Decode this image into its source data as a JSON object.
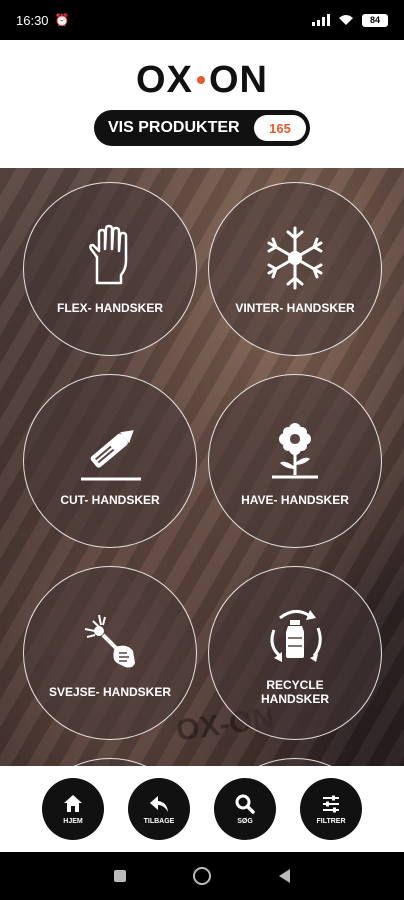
{
  "status_bar": {
    "time": "16:30",
    "battery": "84"
  },
  "header": {
    "logo_left": "OX",
    "logo_right": "ON",
    "vis_label": "VIS PRODUKTER",
    "vis_count": "165"
  },
  "watermark": "OX-ON",
  "categories": [
    {
      "label": "FLEX- HANDSKER",
      "icon": "glove-icon"
    },
    {
      "label": "VINTER- HANDSKER",
      "icon": "snowflake-icon"
    },
    {
      "label": "CUT-  HANDSKER",
      "icon": "cutter-knife-icon"
    },
    {
      "label": "HAVE- HANDSKER",
      "icon": "flower-icon"
    },
    {
      "label": "SVEJSE- HANDSKER",
      "icon": "welding-icon"
    },
    {
      "label": "RECYCLE\nHANDSKER",
      "icon": "recycle-icon"
    }
  ],
  "bottom_nav": [
    {
      "label": "HJEM",
      "icon": "home-icon"
    },
    {
      "label": "TILBAGE",
      "icon": "back-arrow-icon"
    },
    {
      "label": "SØG",
      "icon": "search-icon"
    },
    {
      "label": "FILTRER",
      "icon": "filter-sliders-icon"
    }
  ],
  "colors": {
    "accent": "#e8592b",
    "dark": "#111111"
  }
}
